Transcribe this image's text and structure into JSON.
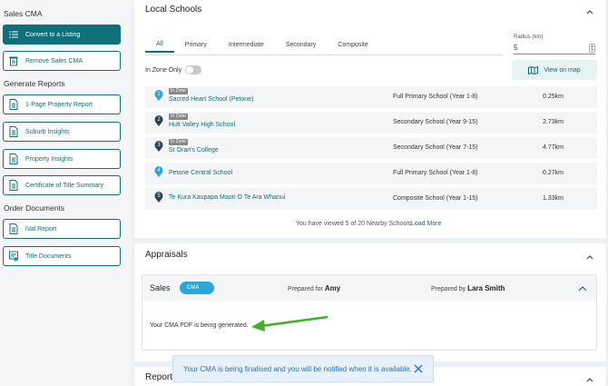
{
  "sidebar": {
    "sales_cma_heading": "Sales CMA",
    "convert_label": "Convert to a Listing",
    "remove_label": "Remove Sales CMA",
    "generate_heading": "Generate Reports",
    "reports": [
      "1-Page Property Report",
      "Suburb Insights",
      "Property Insights",
      "Certificate of Title Summary"
    ],
    "order_heading": "Order Documents",
    "orders": [
      "iVal Report",
      "Title Documents"
    ]
  },
  "schools": {
    "title": "Local Schools",
    "tabs": [
      "All",
      "Primary",
      "Intermediate",
      "Secondary",
      "Composite"
    ],
    "radius_label": "Radius (km)",
    "radius_value": "5",
    "in_zone_label": "In Zone Only",
    "view_map_label": "View on map",
    "zone_badge": "In Zone",
    "rows": [
      {
        "num": "1",
        "name": "Sacred Heart School (Petone)",
        "type": "Full Primary School (Year 1-8)",
        "dist": "0.25km",
        "in_zone": true,
        "color": "#2aa6d8"
      },
      {
        "num": "2",
        "name": "Hutt Valley High School",
        "type": "Secondary School (Year 9-15)",
        "dist": "2.73km",
        "in_zone": true,
        "color": "#2d3e50"
      },
      {
        "num": "3",
        "name": "St Oran's College",
        "type": "Secondary School (Year 7-15)",
        "dist": "4.77km",
        "in_zone": true,
        "color": "#2d3e50"
      },
      {
        "num": "4",
        "name": "Petone Central School",
        "type": "Full Primary School (Year 1-8)",
        "dist": "0.27km",
        "in_zone": false,
        "color": "#2aa6d8"
      },
      {
        "num": "5",
        "name": "Te Kura Kaupapa Maori O Te Ara Whanui",
        "type": "Composite School (Year 1-15)",
        "dist": "1.33km",
        "in_zone": false,
        "color": "#2d3e50"
      }
    ],
    "viewed_text": "You have viewed 5 of 20 Nearby Schools",
    "load_more_label": "Load More"
  },
  "appraisals": {
    "title": "Appraisals",
    "sales_label": "Sales",
    "cma_badge": "CMA",
    "prepared_for_label": "Prepared for",
    "prepared_for_name": "Amy",
    "prepared_by_label": "Prepared by",
    "prepared_by_name": "Lara Smith",
    "generating_text": "Your CMA PDF is being generated."
  },
  "reports_panel": {
    "title": "Reports"
  },
  "toast": {
    "message": "Your CMA is being finalised and you will be notified when it is available."
  },
  "colors": {
    "accent": "#0f6f7a",
    "cma_badge": "#2aa6d8",
    "annotation_arrow": "#3db324"
  }
}
